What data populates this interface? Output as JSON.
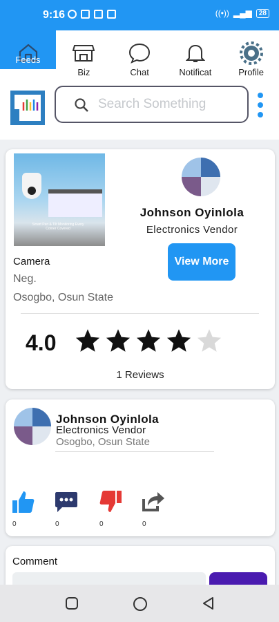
{
  "status_bar": {
    "time": "9:16",
    "battery": "28"
  },
  "nav": {
    "items": [
      {
        "label": "Feeds",
        "icon": "home-icon",
        "active": true
      },
      {
        "label": "Biz",
        "icon": "store-icon"
      },
      {
        "label": "Chat",
        "icon": "chat-icon"
      },
      {
        "label": "Notificat",
        "icon": "bell-icon"
      },
      {
        "label": "Profile",
        "icon": "gear-icon"
      }
    ]
  },
  "search": {
    "placeholder": "Search Something"
  },
  "product_card": {
    "image_caption": "Smart Pan & Tilt Monitoring Every Corner Covered",
    "vendor_name": "Johnson Oyinlola",
    "vendor_role": "Electronics Vendor",
    "view_more_label": "View More",
    "product_name": "Camera",
    "price": "Neg.",
    "location": "Osogbo, Osun State",
    "rating": "4.0",
    "stars_filled": 4,
    "stars_total": 5,
    "reviews": "1 Reviews"
  },
  "vendor_card": {
    "name": "Johnson Oyinlola",
    "role": "Electronics Vendor",
    "location": "Osogbo, Osun State",
    "actions": [
      {
        "icon": "thumbs-up-icon",
        "count": "0",
        "color": "#2196f3"
      },
      {
        "icon": "chat-bubble-icon",
        "count": "0",
        "color": "#2d3a6e"
      },
      {
        "icon": "thumbs-down-icon",
        "count": "0",
        "color": "#e53935"
      },
      {
        "icon": "share-icon",
        "count": "0",
        "color": "#555555"
      }
    ]
  },
  "comment": {
    "label": "Comment"
  },
  "colors": {
    "accent": "#2196f3",
    "submit": "#4a1bb0"
  }
}
